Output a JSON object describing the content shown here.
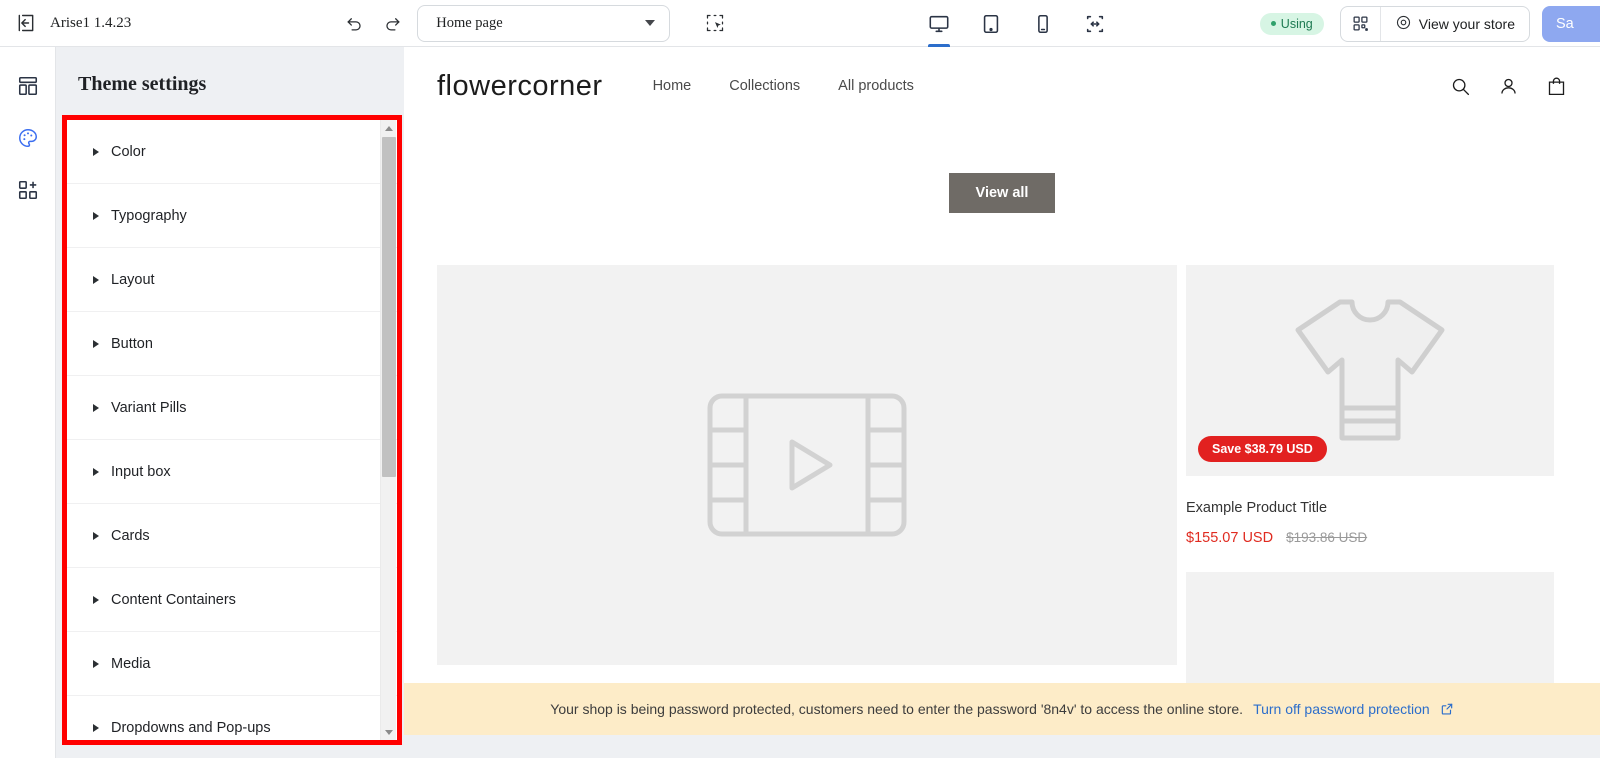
{
  "topbar": {
    "exit_icon": "exit-left-icon",
    "theme_name": "Arise1 1.4.23",
    "undo_icon": "undo-icon",
    "redo_icon": "redo-icon",
    "page_select_value": "Home page",
    "inspector_icon": "inspector-select-icon",
    "devices": [
      {
        "name": "desktop",
        "icon": "desktop-icon",
        "active": true
      },
      {
        "name": "tablet",
        "icon": "tablet-icon",
        "active": false
      },
      {
        "name": "mobile",
        "icon": "mobile-icon",
        "active": false
      },
      {
        "name": "fullwidth",
        "icon": "fullscreen-width-icon",
        "active": false
      }
    ],
    "using_badge": "Using",
    "qr_icon": "qr-code-icon",
    "view_store_label": "View your store",
    "view_store_icon": "eye-icon",
    "save_label": "Sa"
  },
  "rail": {
    "items": [
      {
        "name": "sections-icon",
        "label": "Sections",
        "active": false
      },
      {
        "name": "palette-icon",
        "label": "Theme settings",
        "active": true
      },
      {
        "name": "apps-add-icon",
        "label": "Apps",
        "active": false
      }
    ]
  },
  "panel": {
    "title": "Theme settings",
    "items": [
      {
        "label": "Color"
      },
      {
        "label": "Typography"
      },
      {
        "label": "Layout"
      },
      {
        "label": "Button"
      },
      {
        "label": "Variant Pills"
      },
      {
        "label": "Input box"
      },
      {
        "label": "Cards"
      },
      {
        "label": "Content Containers"
      },
      {
        "label": "Media"
      },
      {
        "label": "Dropdowns and Pop-ups"
      }
    ],
    "highlight_color": "#ff0000"
  },
  "store": {
    "brand": "flowercorner",
    "nav": [
      {
        "label": "Home"
      },
      {
        "label": "Collections"
      },
      {
        "label": "All products"
      }
    ],
    "actions": [
      {
        "name": "search-icon"
      },
      {
        "name": "account-icon"
      },
      {
        "name": "cart-icon"
      }
    ],
    "view_all_label": "View all",
    "media_placeholder_icon": "video-placeholder-icon",
    "product": {
      "placeholder_icon": "tshirt-placeholder-icon",
      "save_badge": "Save $38.79 USD",
      "title": "Example Product Title",
      "price": "$155.07 USD",
      "compare_price": "$193.86 USD"
    }
  },
  "banner": {
    "text": "Your shop is being password protected, customers need to enter the password '8n4v' to access the online store.",
    "link_label": "Turn off password protection",
    "link_icon": "external-link-icon",
    "background": "#fdecc8"
  }
}
